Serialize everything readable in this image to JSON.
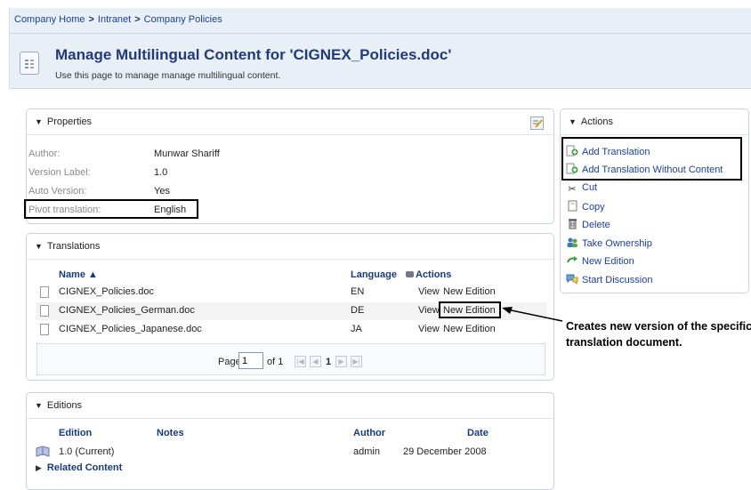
{
  "breadcrumb": {
    "items": [
      "Company Home",
      "Intranet",
      "Company Policies"
    ],
    "separator": ">"
  },
  "page": {
    "title": "Manage Multilingual Content for 'CIGNEX_Policies.doc'",
    "description": "Use this page to manage manage multilingual content."
  },
  "properties": {
    "title": "Properties",
    "rows": [
      {
        "label": "Author:",
        "value": "Munwar Shariff"
      },
      {
        "label": "Version Label:",
        "value": "1.0"
      },
      {
        "label": "Auto Version:",
        "value": "Yes"
      },
      {
        "label": "Pivot translation:",
        "value": "English"
      }
    ]
  },
  "translations": {
    "title": "Translations",
    "headers": {
      "name": "Name ▲",
      "language": "Language",
      "actions": "Actions"
    },
    "rows": [
      {
        "name": "CIGNEX_Policies.doc",
        "language": "EN",
        "view": "View",
        "new_edition": "New Edition"
      },
      {
        "name": "CIGNEX_Policies_German.doc",
        "language": "DE",
        "view": "View",
        "new_edition": "New Edition"
      },
      {
        "name": "CIGNEX_Policies_Japanese.doc",
        "language": "JA",
        "view": "View",
        "new_edition": "New Edition"
      }
    ],
    "pager": {
      "page_label": "Page",
      "current": "1",
      "of_label": "of 1",
      "page_number": "1"
    }
  },
  "editions": {
    "title": "Editions",
    "headers": {
      "edition": "Edition",
      "notes": "Notes",
      "author": "Author",
      "date": "Date"
    },
    "rows": [
      {
        "edition": "1.0 (Current)",
        "notes": "",
        "author": "admin",
        "date": "29 December 2008"
      }
    ],
    "related": "Related Content"
  },
  "actions": {
    "title": "Actions",
    "items": [
      {
        "label": "Add Translation",
        "icon": "add-doc-icon"
      },
      {
        "label": "Add Translation Without Content",
        "icon": "add-doc-icon"
      },
      {
        "label": "Cut",
        "icon": "scissors-icon"
      },
      {
        "label": "Copy",
        "icon": "copy-icon"
      },
      {
        "label": "Delete",
        "icon": "trash-icon"
      },
      {
        "label": "Take Ownership",
        "icon": "users-icon"
      },
      {
        "label": "New Edition",
        "icon": "arrow-icon"
      },
      {
        "label": "Start Discussion",
        "icon": "discussion-icon"
      }
    ]
  },
  "callout": {
    "text": "Creates new version of the specific translation document."
  }
}
